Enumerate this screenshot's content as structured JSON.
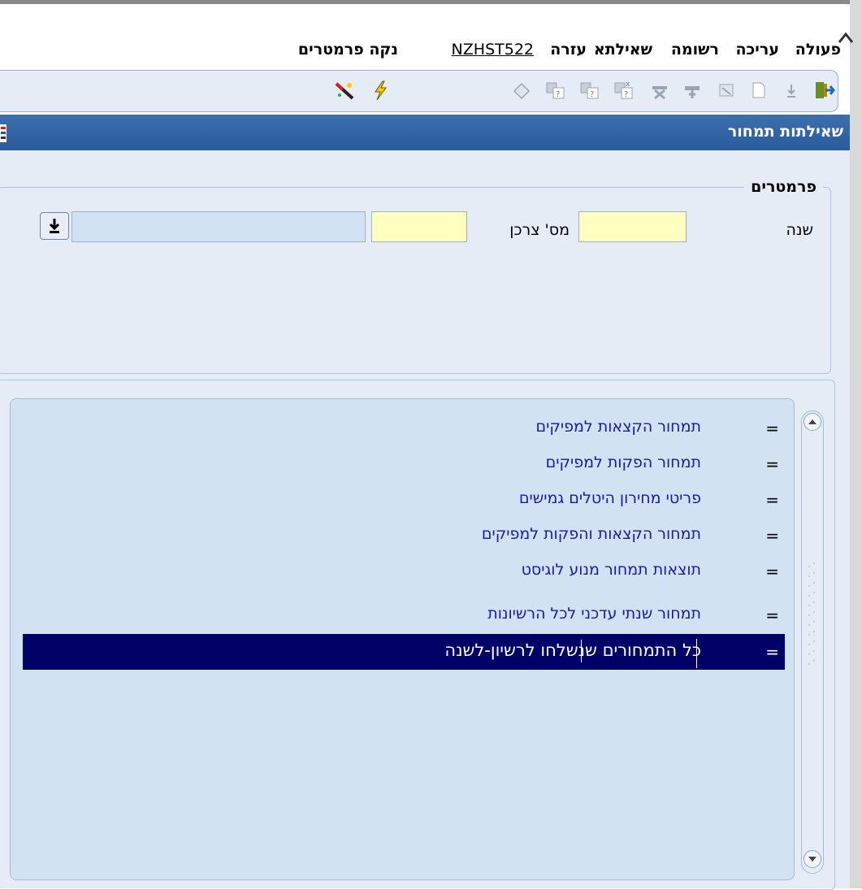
{
  "menu": {
    "action": "פעולה",
    "edit": "עריכה",
    "record": "רשומה",
    "query": "שאילתא",
    "help": "עזרה",
    "form_code": "NZHST522",
    "clear_params": "נקה פרמטרים"
  },
  "toolbar": {
    "icons": [
      "exit-icon",
      "download-icon",
      "new-record-icon",
      "attach-icon",
      "insert-record-icon",
      "delete-record-icon",
      "query-all-icon",
      "query-icon",
      "query-count-icon",
      "save-icon",
      "lightning-icon",
      "wand-icon"
    ]
  },
  "window": {
    "title": "שאילתות תמחור"
  },
  "params": {
    "legend": "פרמטרים",
    "year_label": "שנה",
    "year_value": "",
    "consumer_label": "מס' צרכן",
    "consumer_value": "",
    "consumer_name_value": ""
  },
  "list": {
    "items": [
      {
        "eq": "=",
        "text": "תמחור הקצאות למפיקים"
      },
      {
        "eq": "=",
        "text": "תמחור הפקות למפיקים"
      },
      {
        "eq": "=",
        "text": "פריטי מחירון היטלים גמישים"
      },
      {
        "eq": "=",
        "text": "תמחור הקצאות והפקות למפיקים"
      },
      {
        "eq": "=",
        "text": "תוצאות תמחור מנוע לוגיסט"
      },
      {
        "eq": "=",
        "text": "תמחור שנתי עדכני לכל הרשיונות"
      },
      {
        "eq": "=",
        "text": "כל התמחורים שנשלחו לרשיון-לשנה"
      }
    ],
    "selected_index": 6
  },
  "colors": {
    "panel_bg": "#e5ecf6",
    "title_bar": "#2a5b9c",
    "selected_row": "#000066",
    "list_text": "#1a1aa6",
    "required_field": "#ffffc0"
  }
}
